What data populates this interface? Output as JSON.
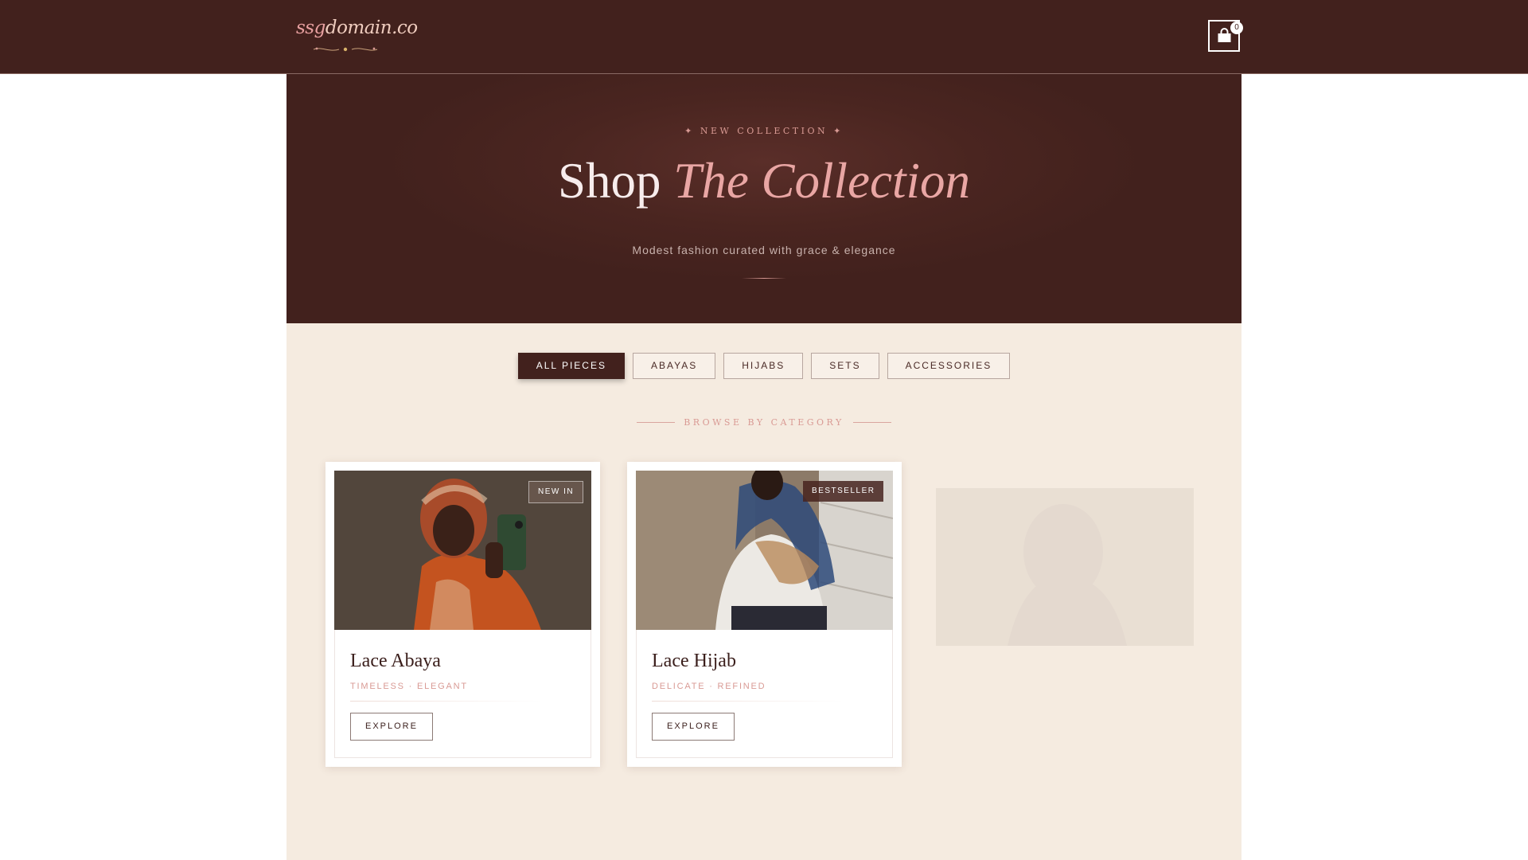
{
  "header": {
    "logo_text_a": "ssg",
    "logo_text_b": "domain.co",
    "cart_count": "0",
    "cart_icon": "shopping-bag-icon"
  },
  "hero": {
    "eyebrow": "✦ NEW COLLECTION ✦",
    "title_plain": "Shop ",
    "title_accent": "The Collection",
    "subtitle": "Modest fashion curated with grace & elegance"
  },
  "filters": [
    {
      "label": "ALL PIECES",
      "active": true
    },
    {
      "label": "ABAYAS",
      "active": false
    },
    {
      "label": "HIJABS",
      "active": false
    },
    {
      "label": "SETS",
      "active": false
    },
    {
      "label": "ACCESSORIES",
      "active": false
    }
  ],
  "browse_label": "BROWSE BY CATEGORY",
  "products": [
    {
      "name": "Lace Abaya",
      "tags": "TIMELESS · ELEGANT",
      "badge": "NEW IN",
      "button": "EXPLORE"
    },
    {
      "name": "Lace Hijab",
      "tags": "DELICATE · REFINED",
      "badge": "BESTSELLER",
      "button": "EXPLORE"
    }
  ],
  "colors": {
    "header_bg": "#42211d",
    "page_bg": "#f5ebe0",
    "accent_pink": "#e9a6a4",
    "active_filter": "#42211d"
  }
}
